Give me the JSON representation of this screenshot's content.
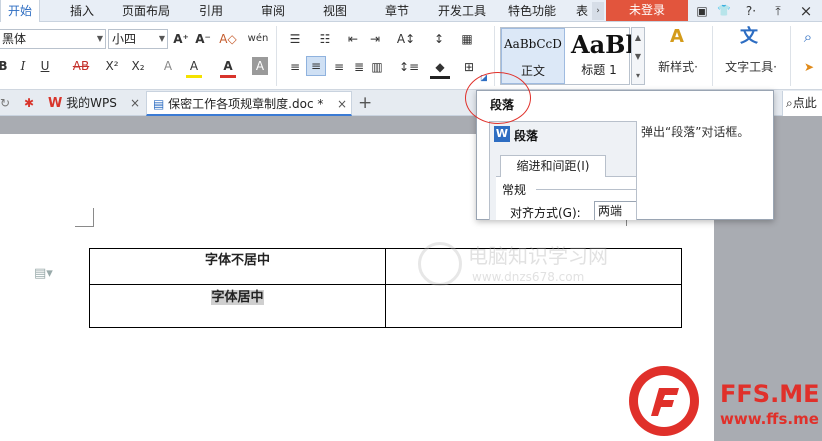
{
  "menu": {
    "tabs": [
      "开始",
      "插入",
      "页面布局",
      "引用",
      "审阅",
      "视图",
      "章节",
      "开发工具",
      "特色功能",
      "表"
    ],
    "active_tab": "开始",
    "login_label": "未登录",
    "scroll_glyph": "›",
    "win_icons": {
      "skin": "▣",
      "shirt": "👕",
      "help": "?·",
      "upload": "⤒",
      "close": "×"
    }
  },
  "ribbon": {
    "font_name": "黑体",
    "font_size": "小四",
    "grow_font": "A⁺",
    "shrink_font": "A⁻",
    "clear_format": "A◇",
    "phonetic": "wén",
    "bold": "B",
    "italic": "I",
    "underline": "U",
    "strike": "AB",
    "superscript": "X²",
    "subscript": "X₂",
    "highlight": "A",
    "font_color": "A",
    "char_shading": "A",
    "style_normal_preview": "AaBbCcD",
    "style_normal_label": "正文",
    "style_h1_preview": "AaBl",
    "style_h1_label": "标题 1",
    "new_style_label": "新样式·",
    "text_tools_label": "文字工具·"
  },
  "tabs": {
    "home_label": "我的WPS",
    "doc_label": "保密工作各项规章制度.doc *",
    "close_glyph": "×",
    "add_glyph": "+",
    "search_hint": "点此"
  },
  "document": {
    "cell_1": "字体不居中",
    "cell_2": "字体居中"
  },
  "popup": {
    "title": "段落",
    "description": "弹出“段落”对话框。",
    "dialog_logo": "W",
    "dialog_title": "段落",
    "dialog_tab": "缩进和间距(I)",
    "section_label": "常规",
    "align_label": "对齐方式(G):",
    "align_value": "两端"
  },
  "watermark": {
    "name": "电脑知识学习网",
    "url": "www.dnzs678.com"
  },
  "brand": {
    "name": "FFS.ME",
    "url": "www.ffs.me",
    "color": "#e0302a"
  }
}
